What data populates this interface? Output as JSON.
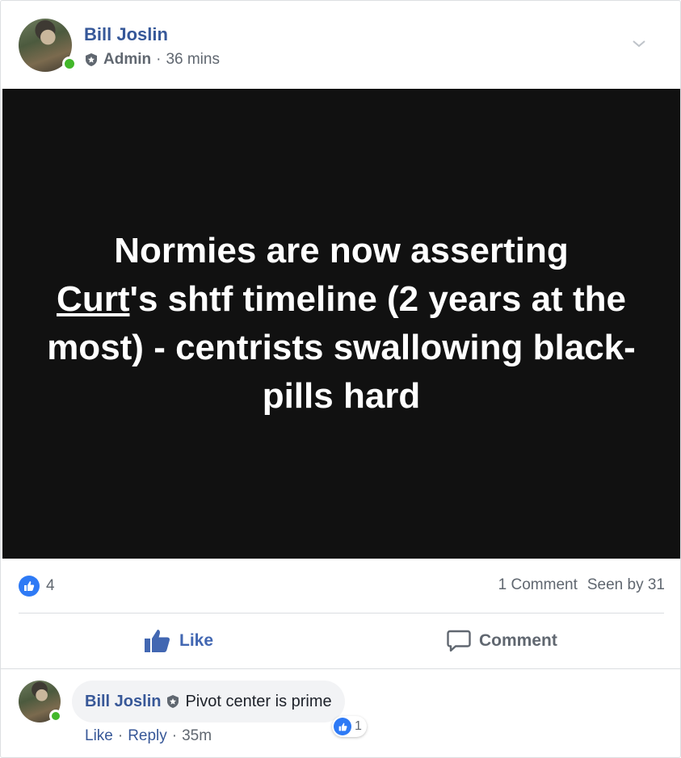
{
  "post": {
    "author": "Bill Joslin",
    "role": "Admin",
    "separator": "·",
    "time": "36 mins",
    "text_parts": {
      "line1": "Normies are now asserting",
      "mention": "Curt",
      "after_mention": "'s shtf timeline (2 years at the most) - centrists swallowing black-pills hard"
    }
  },
  "stats": {
    "like_count": "4",
    "comments": "1 Comment",
    "seen_by": "Seen by 31"
  },
  "actions": {
    "like_label": "Like",
    "comment_label": "Comment"
  },
  "comment": {
    "author": "Bill Joslin",
    "text": "Pivot center is prime",
    "reaction_count": "1",
    "like_label": "Like",
    "reply_label": "Reply",
    "separator": "·",
    "time": "35m"
  },
  "colors": {
    "link_blue": "#365899",
    "like_blue": "#2e7af5",
    "online_green": "#42b72a",
    "image_bg": "#111111"
  },
  "icons": {
    "admin": "shield-icon",
    "menu": "chevron-down-icon",
    "like": "thumbs-up-icon",
    "comment": "speech-bubble-icon"
  }
}
